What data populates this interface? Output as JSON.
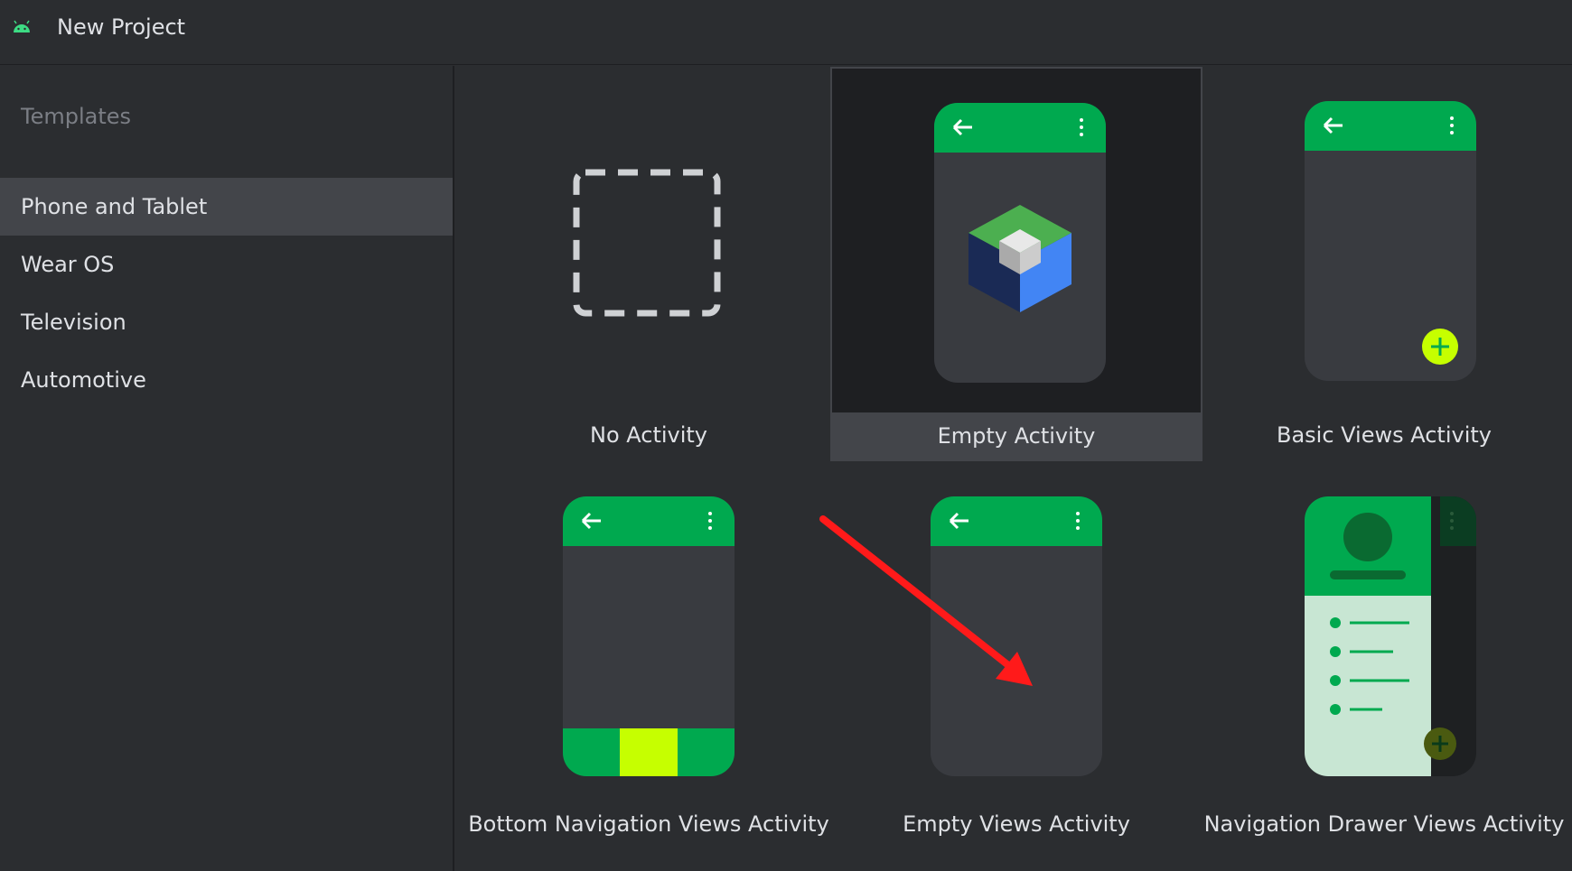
{
  "window": {
    "title": "New Project",
    "icon": "android-icon"
  },
  "sidebar": {
    "heading": "Templates",
    "items": [
      {
        "label": "Phone and Tablet",
        "selected": true
      },
      {
        "label": "Wear OS",
        "selected": false
      },
      {
        "label": "Television",
        "selected": false
      },
      {
        "label": "Automotive",
        "selected": false
      }
    ]
  },
  "templates": [
    {
      "label": "No Activity",
      "selected": false
    },
    {
      "label": "Empty Activity",
      "selected": true
    },
    {
      "label": "Basic Views Activity",
      "selected": false
    },
    {
      "label": "Bottom Navigation Views Activity",
      "selected": false
    },
    {
      "label": "Empty Views Activity",
      "selected": false
    },
    {
      "label": "Navigation Drawer Views Activity",
      "selected": false
    }
  ],
  "colors": {
    "background": "#2b2d30",
    "phone_body": "#393b40",
    "appbar_green": "#00a94f",
    "fab_yellow": "#c6ff00",
    "annotation_red": "#ff1a1a"
  }
}
